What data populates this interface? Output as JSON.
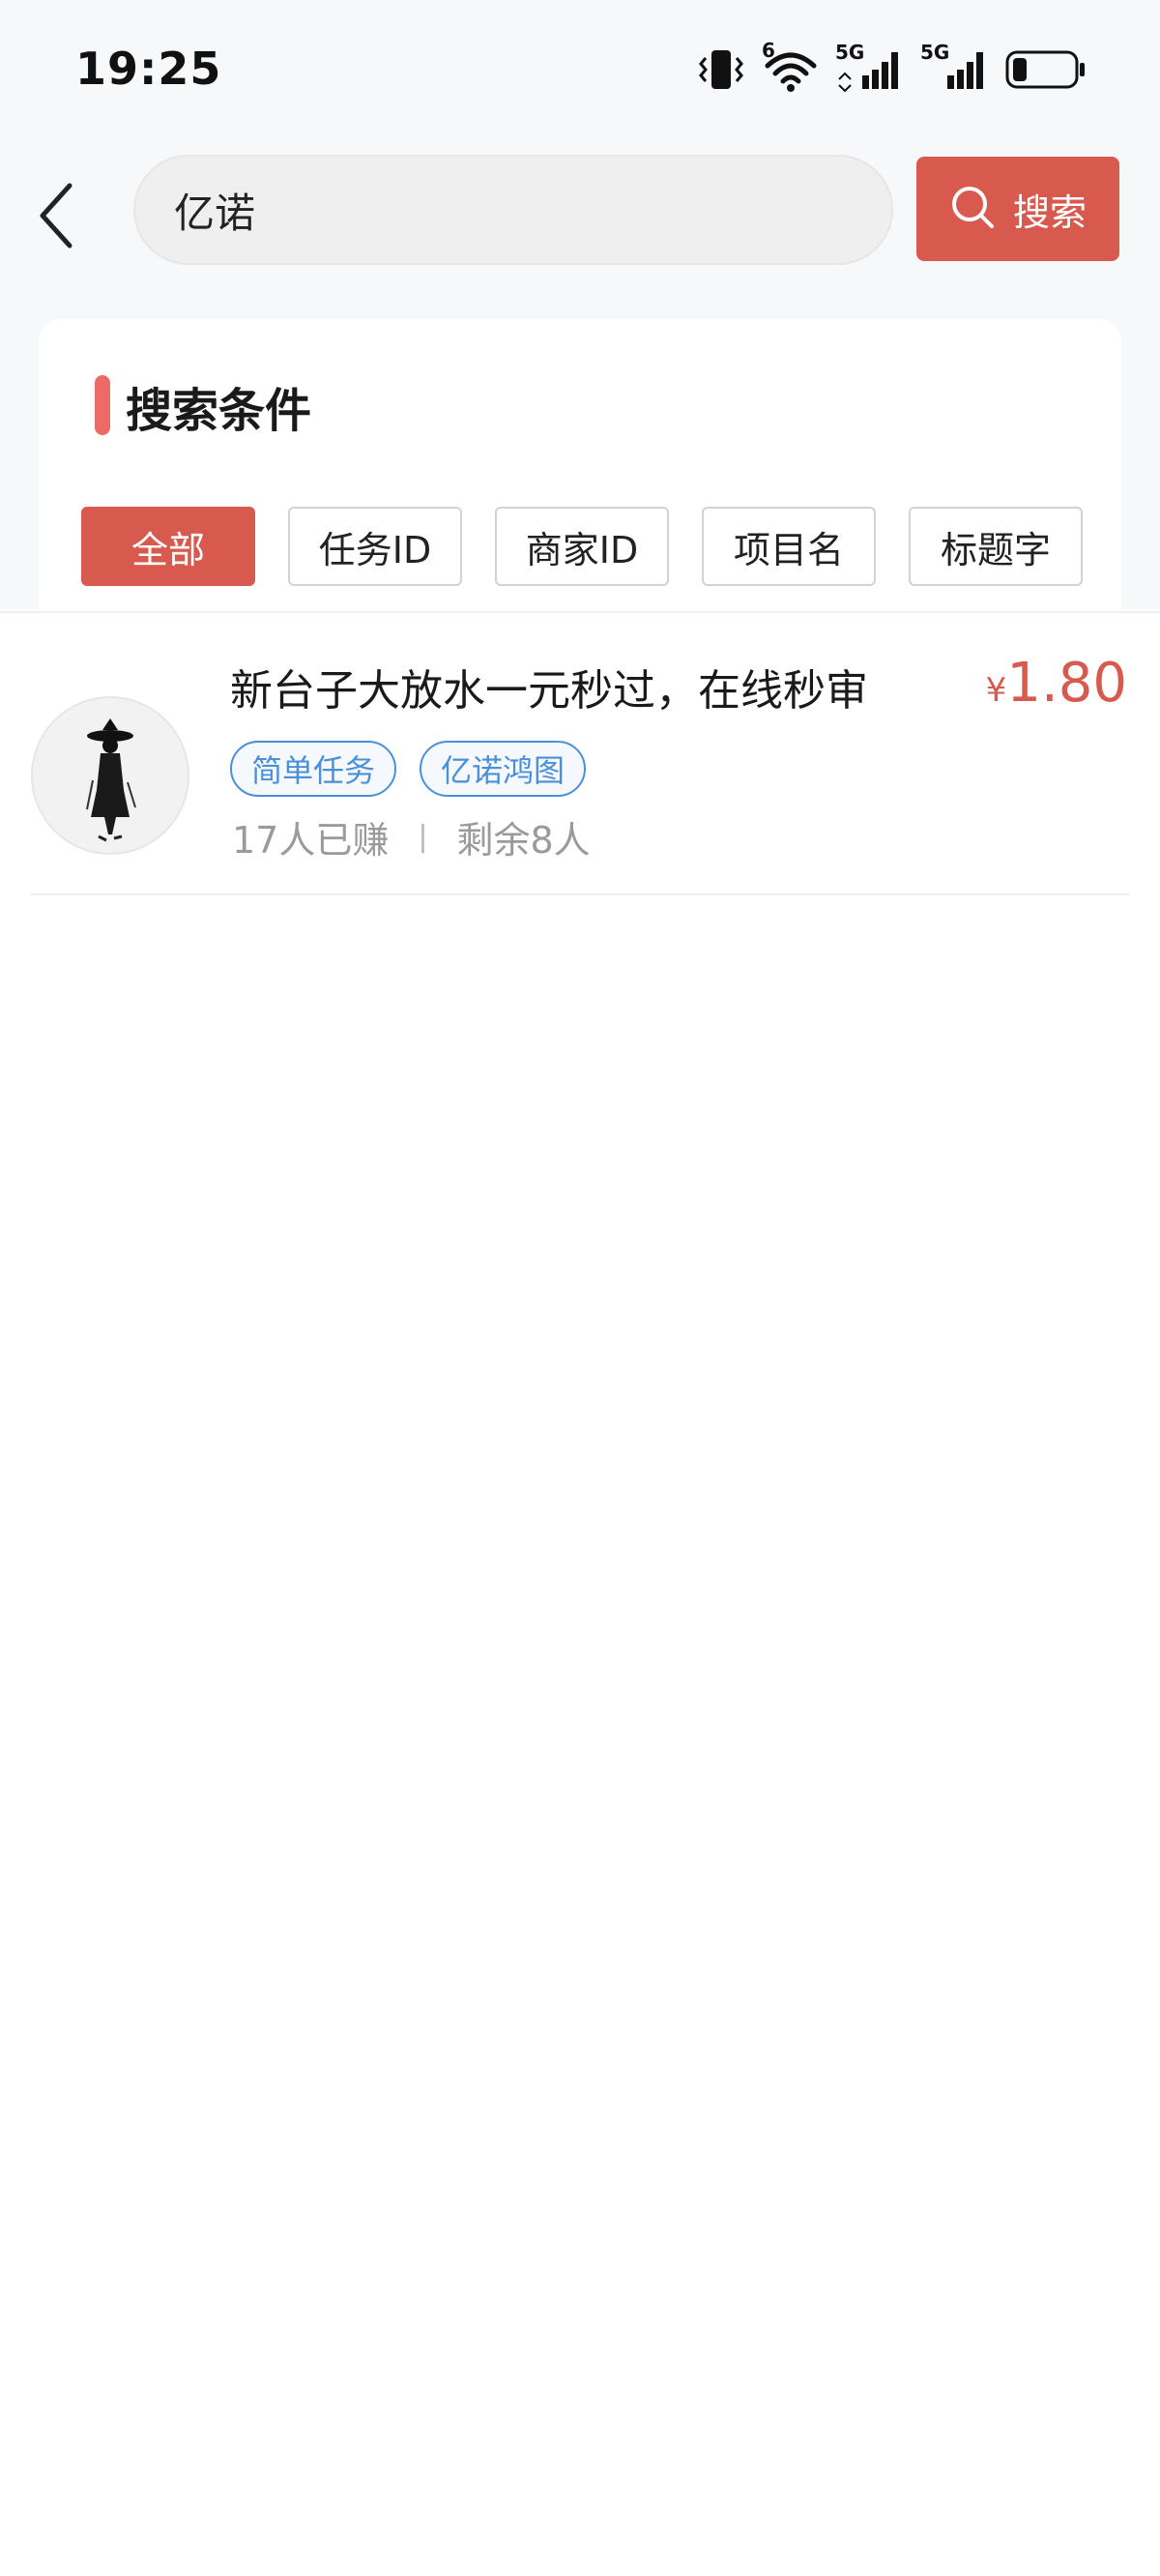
{
  "status_bar": {
    "time": "19:25",
    "icons": [
      "vibrate-icon",
      "wifi-icon",
      "signal-5g-icon",
      "signal-5g-icon",
      "battery-icon"
    ],
    "wifi_badge": "6",
    "network_labels": [
      "5G",
      "5G"
    ],
    "battery_level": 0.2
  },
  "header": {
    "back_icon": "chevron-left-icon",
    "search_value": "亿诺",
    "search_button_label": "搜索",
    "search_button_icon": "search-icon"
  },
  "conditions": {
    "title": "搜索条件",
    "filters": [
      "全部",
      "任务ID",
      "商家ID",
      "项目名",
      "标题字"
    ],
    "active_filter": "全部"
  },
  "results": [
    {
      "title": "新台子大放水一元秒过，在线秒审",
      "price_symbol": "¥",
      "price": "1.80",
      "tags": [
        "简单任务",
        "亿诺鸿图"
      ],
      "earned": "17人已赚",
      "separator": "|",
      "remaining": "剩余8人"
    }
  ],
  "colors": {
    "accent": "#d85a4f",
    "tag_blue": "#4a90d9",
    "title_bar": "#ee6a66",
    "background": "#f7f8fa"
  }
}
